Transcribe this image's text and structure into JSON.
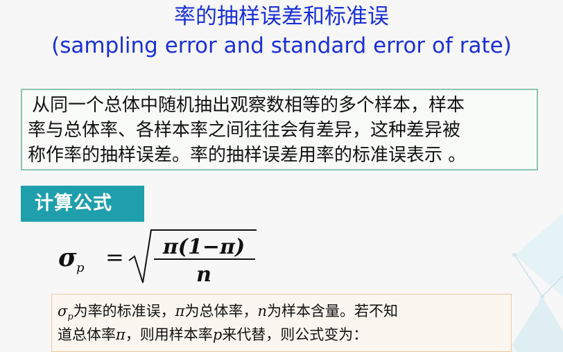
{
  "title": {
    "cn": "率的抽样误差和标准误",
    "en": "(sampling error and standard error of rate)"
  },
  "definition": {
    "line1": "从同一个总体中随机抽出观察数相等的多个样本，样本",
    "line2": "率与总体率、各样本率之间往往会有差异，这种差异被",
    "line3": "称作率的抽样误差。率的抽样误差用率的标准误表示 。"
  },
  "formula_section": {
    "label": "计算公式",
    "formula": {
      "lhs": "σ",
      "lhs_sub": "p",
      "equals": "=",
      "numerator": "π(1−π)",
      "denominator": "n"
    }
  },
  "note": {
    "sym_sigma": "σ",
    "sym_p_sub": "p",
    "text1": "为率的标准误，",
    "sym_pi": "π",
    "text2": "为总体率，",
    "sym_n": "n",
    "text3": "为样本含量。若不知",
    "text4": "道总体率",
    "sym_pi2": "π",
    "text5": "，则用样本率",
    "sym_p": "p",
    "text6": "来代替，则公式变为："
  },
  "colors": {
    "title": "#1a2fd6",
    "badge_bg": "#1f9fac",
    "definition_border": "#8cc4b0",
    "note_border": "#efc79c"
  }
}
